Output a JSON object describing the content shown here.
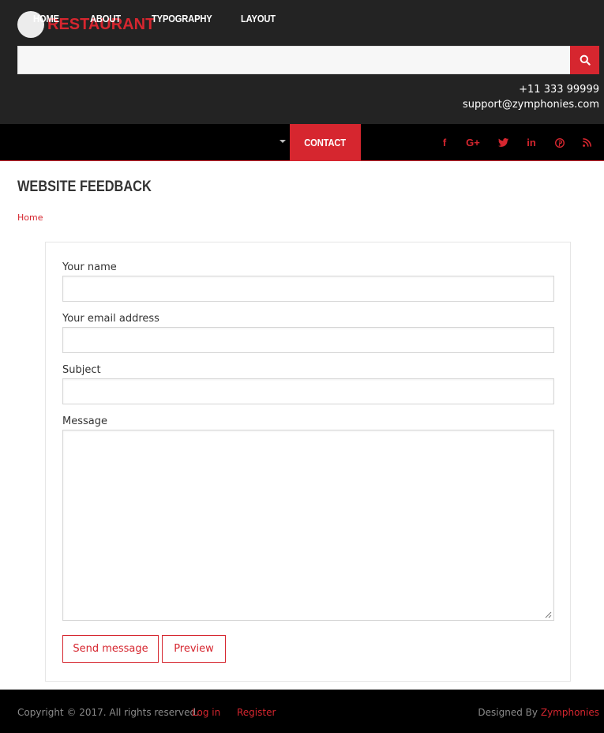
{
  "header": {
    "brand": "RESTAURANT",
    "search": {
      "value": "",
      "placeholder": ""
    },
    "phone": "+11 333 99999",
    "email": "support@zymphonies.com"
  },
  "nav": {
    "items": [
      {
        "label": "HOME"
      },
      {
        "label": "ABOUT"
      },
      {
        "label": "TYPOGRAPHY"
      },
      {
        "label": "LAYOUT"
      },
      {
        "label": "CONTACT",
        "active": true
      }
    ],
    "social": [
      {
        "icon": "facebook-icon",
        "glyph": "f"
      },
      {
        "icon": "google-plus-icon",
        "glyph": "G+"
      },
      {
        "icon": "twitter-icon",
        "glyph": "t"
      },
      {
        "icon": "linkedin-icon",
        "glyph": "in"
      },
      {
        "icon": "pinterest-icon",
        "glyph": "p"
      },
      {
        "icon": "rss-icon",
        "glyph": "rss"
      }
    ]
  },
  "page": {
    "title": "WEBSITE FEEDBACK",
    "breadcrumb": "Home"
  },
  "form": {
    "name_label": "Your name",
    "name_value": "",
    "email_label": "Your email address",
    "email_value": "",
    "subject_label": "Subject",
    "subject_value": "",
    "message_label": "Message",
    "message_value": "",
    "send_label": "Send message",
    "preview_label": "Preview"
  },
  "footer": {
    "copyright": "Copyright © 2017. All rights reserved.",
    "login": "Log in",
    "register": "Register",
    "designed_by": "Designed By",
    "designer": "Zymphonies"
  },
  "colors": {
    "accent": "#d6262f",
    "header_bg": "#232323",
    "nav_bg": "#000000"
  }
}
